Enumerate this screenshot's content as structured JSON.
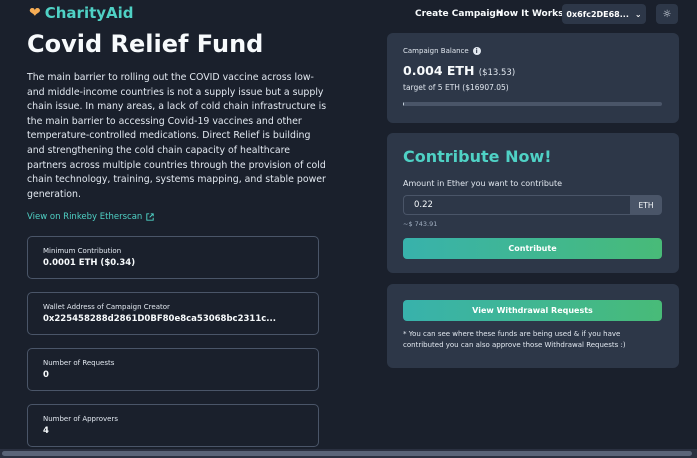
{
  "nav": {
    "brand": "CharityAid",
    "create_campaign": "Create Campaign",
    "how_it_works": "How It Works",
    "wallet": "0x6fc2DE68...",
    "wallet_chevron": "⌄",
    "theme_icon": "☼"
  },
  "campaign": {
    "title": "Covid Relief Fund",
    "description": "The main barrier to rolling out the COVID vaccine across low- and middle-income countries is not a supply issue but a supply chain issue. In many areas, a lack of cold chain infrastructure is the main barrier to accessing Covid-19 vaccines and other temperature-controlled medications. Direct Relief is building and strengthening the cold chain capacity of healthcare partners across multiple countries through the provision of cold chain technology, training, systems mapping, and stable power generation.",
    "etherscan_link": "View on Rinkeby Etherscan"
  },
  "stats": [
    {
      "label": "Minimum Contribution",
      "value": "0.0001 ETH ($0.34)"
    },
    {
      "label": "Wallet Address of Campaign Creator",
      "value": "0x225458288d2861D0BF80e8ca53068bc2311c..."
    },
    {
      "label": "Number of Requests",
      "value": "0"
    },
    {
      "label": "Number of Approvers",
      "value": "4"
    }
  ],
  "balance": {
    "label": "Campaign Balance",
    "info_icon": "i",
    "eth": "0.004 ETH",
    "usd": "($13.53)",
    "target": "target of 5 ETH ($16907.05)",
    "progress_fraction": 0.0008
  },
  "contribute": {
    "title": "Contribute Now!",
    "amount_label": "Amount in Ether you want to contribute",
    "amount_value": "0.22",
    "unit": "ETH",
    "usd_hint": "~$ 743.91",
    "button": "Contribute"
  },
  "withdrawal": {
    "button": "View Withdrawal Requests",
    "note": "* You can see where these funds are being used & if you have contributed you can also approve those Withdrawal Requests :)"
  },
  "colors": {
    "background": "#1a202c",
    "card": "#2d3748",
    "accent": "#4fd1c5"
  }
}
